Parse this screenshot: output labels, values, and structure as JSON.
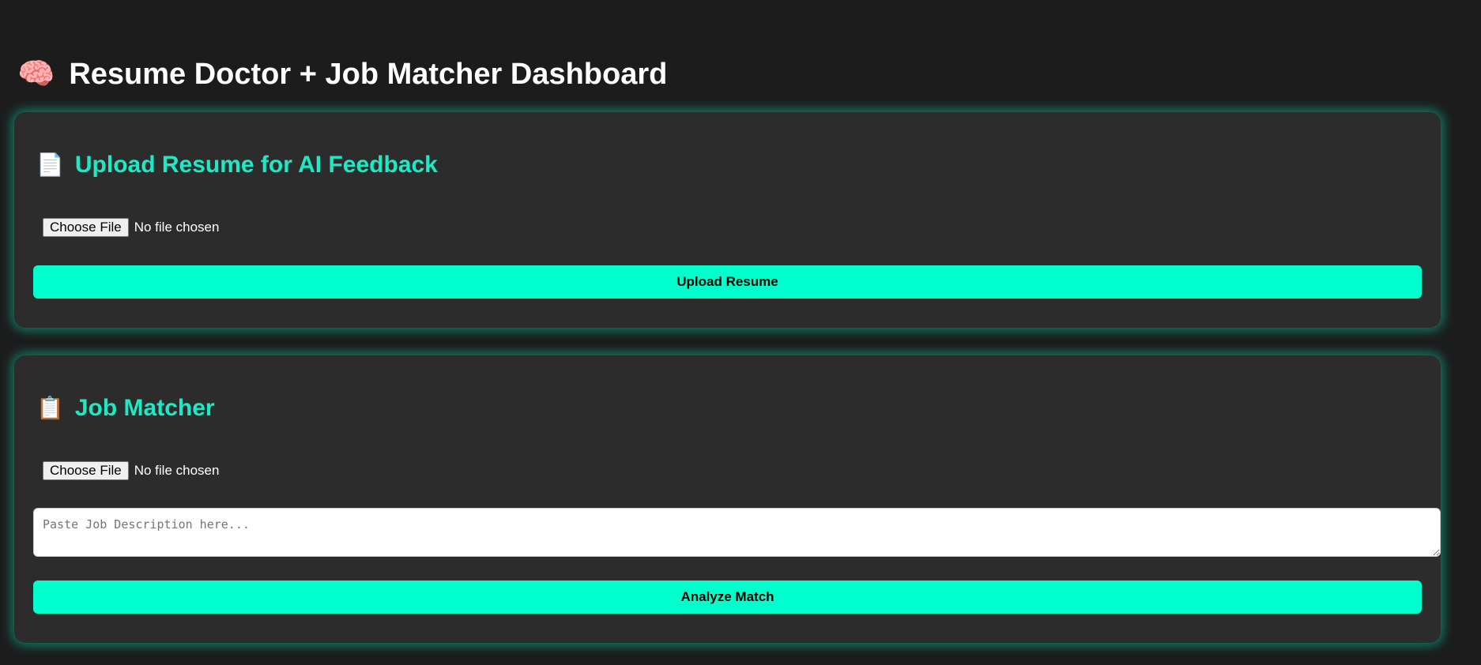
{
  "header": {
    "icon": "brain-icon",
    "emoji": "🧠",
    "title": "Resume Doctor + Job Matcher Dashboard"
  },
  "upload_section": {
    "icon": "document-icon",
    "emoji": "📄",
    "heading": "Upload Resume for AI Feedback",
    "file_button_label": "Choose File",
    "file_status": "No file chosen",
    "submit_label": "Upload Resume"
  },
  "matcher_section": {
    "icon": "clipboard-icon",
    "emoji": "📋",
    "heading": "Job Matcher",
    "file_button_label": "Choose File",
    "file_status": "No file chosen",
    "textarea_value": "",
    "textarea_placeholder": "Paste Job Description here...",
    "submit_label": "Analyze Match"
  },
  "colors": {
    "background": "#1c1c1c",
    "card": "#2c2c2c",
    "accent": "#00ffcc",
    "heading_accent": "#1de9c4"
  }
}
